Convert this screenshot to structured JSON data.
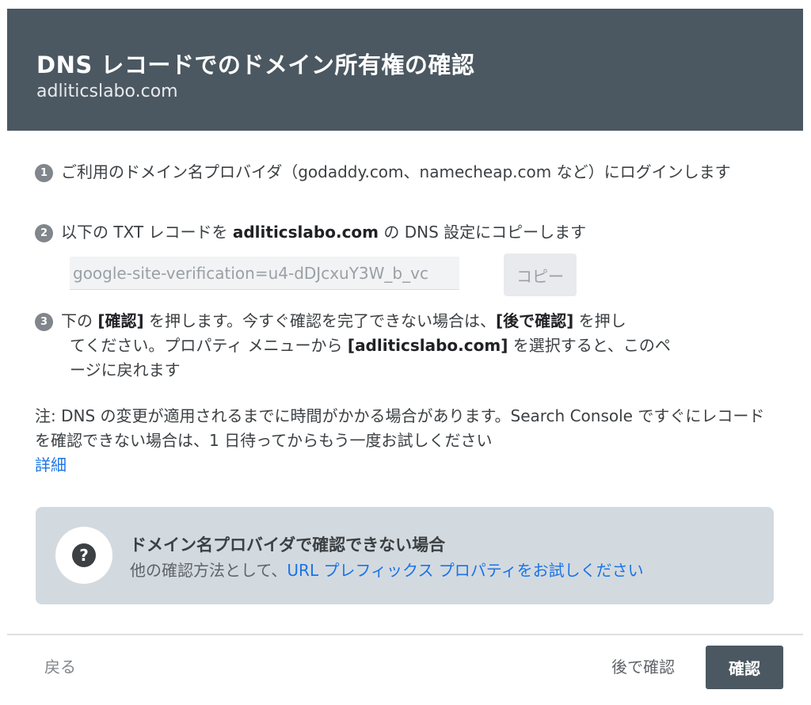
{
  "header": {
    "title": "DNS レコードでのドメイン所有権の確認",
    "subtitle": "adliticslabo.com"
  },
  "steps": [
    {
      "number": "1",
      "text": "ご利用のドメイン名プロバイダ（godaddy.com、namecheap.com など）にログインします"
    },
    {
      "number": "2",
      "text_before": "以下の TXT レコードを ",
      "domain": "adliticslabo.com",
      "text_after": " の DNS 設定にコピーします"
    },
    {
      "number": "3",
      "text_a": "下の ",
      "verify_label": "[確認]",
      "text_b": " を押します。今すぐ確認を完了できない場合は、",
      "later_label": "[後で確認]",
      "text_c": " を押し",
      "text_d": "てください。プロパティ メニューから ",
      "property_label": "[adliticslabo.com]",
      "text_e": " を選択すると、このペ",
      "text_f": "ージに戻れます"
    }
  ],
  "record": {
    "value": "google-site-verification=u4-dDJcxuY3W_b_vc",
    "copy_label": "コピー"
  },
  "note": {
    "text": "注: DNS の変更が適用されるまでに時間がかかる場合があります。Search Console ですぐにレコードを確認できない場合は、1 日待ってからもう一度お試しください",
    "link_label": "詳細"
  },
  "help": {
    "icon_glyph": "?",
    "title": "ドメイン名プロバイダで確認できない場合",
    "text_before": "他の確認方法として、",
    "link_label": "URL プレフィックス プロパティをお試しください"
  },
  "footer": {
    "back_label": "戻る",
    "later_label": "後で確認",
    "verify_label": "確認"
  },
  "colors": {
    "header_bg": "#4b5861",
    "link": "#1a73e8",
    "help_card_bg": "#d3dadf",
    "primary_button_bg": "#4b5861"
  }
}
